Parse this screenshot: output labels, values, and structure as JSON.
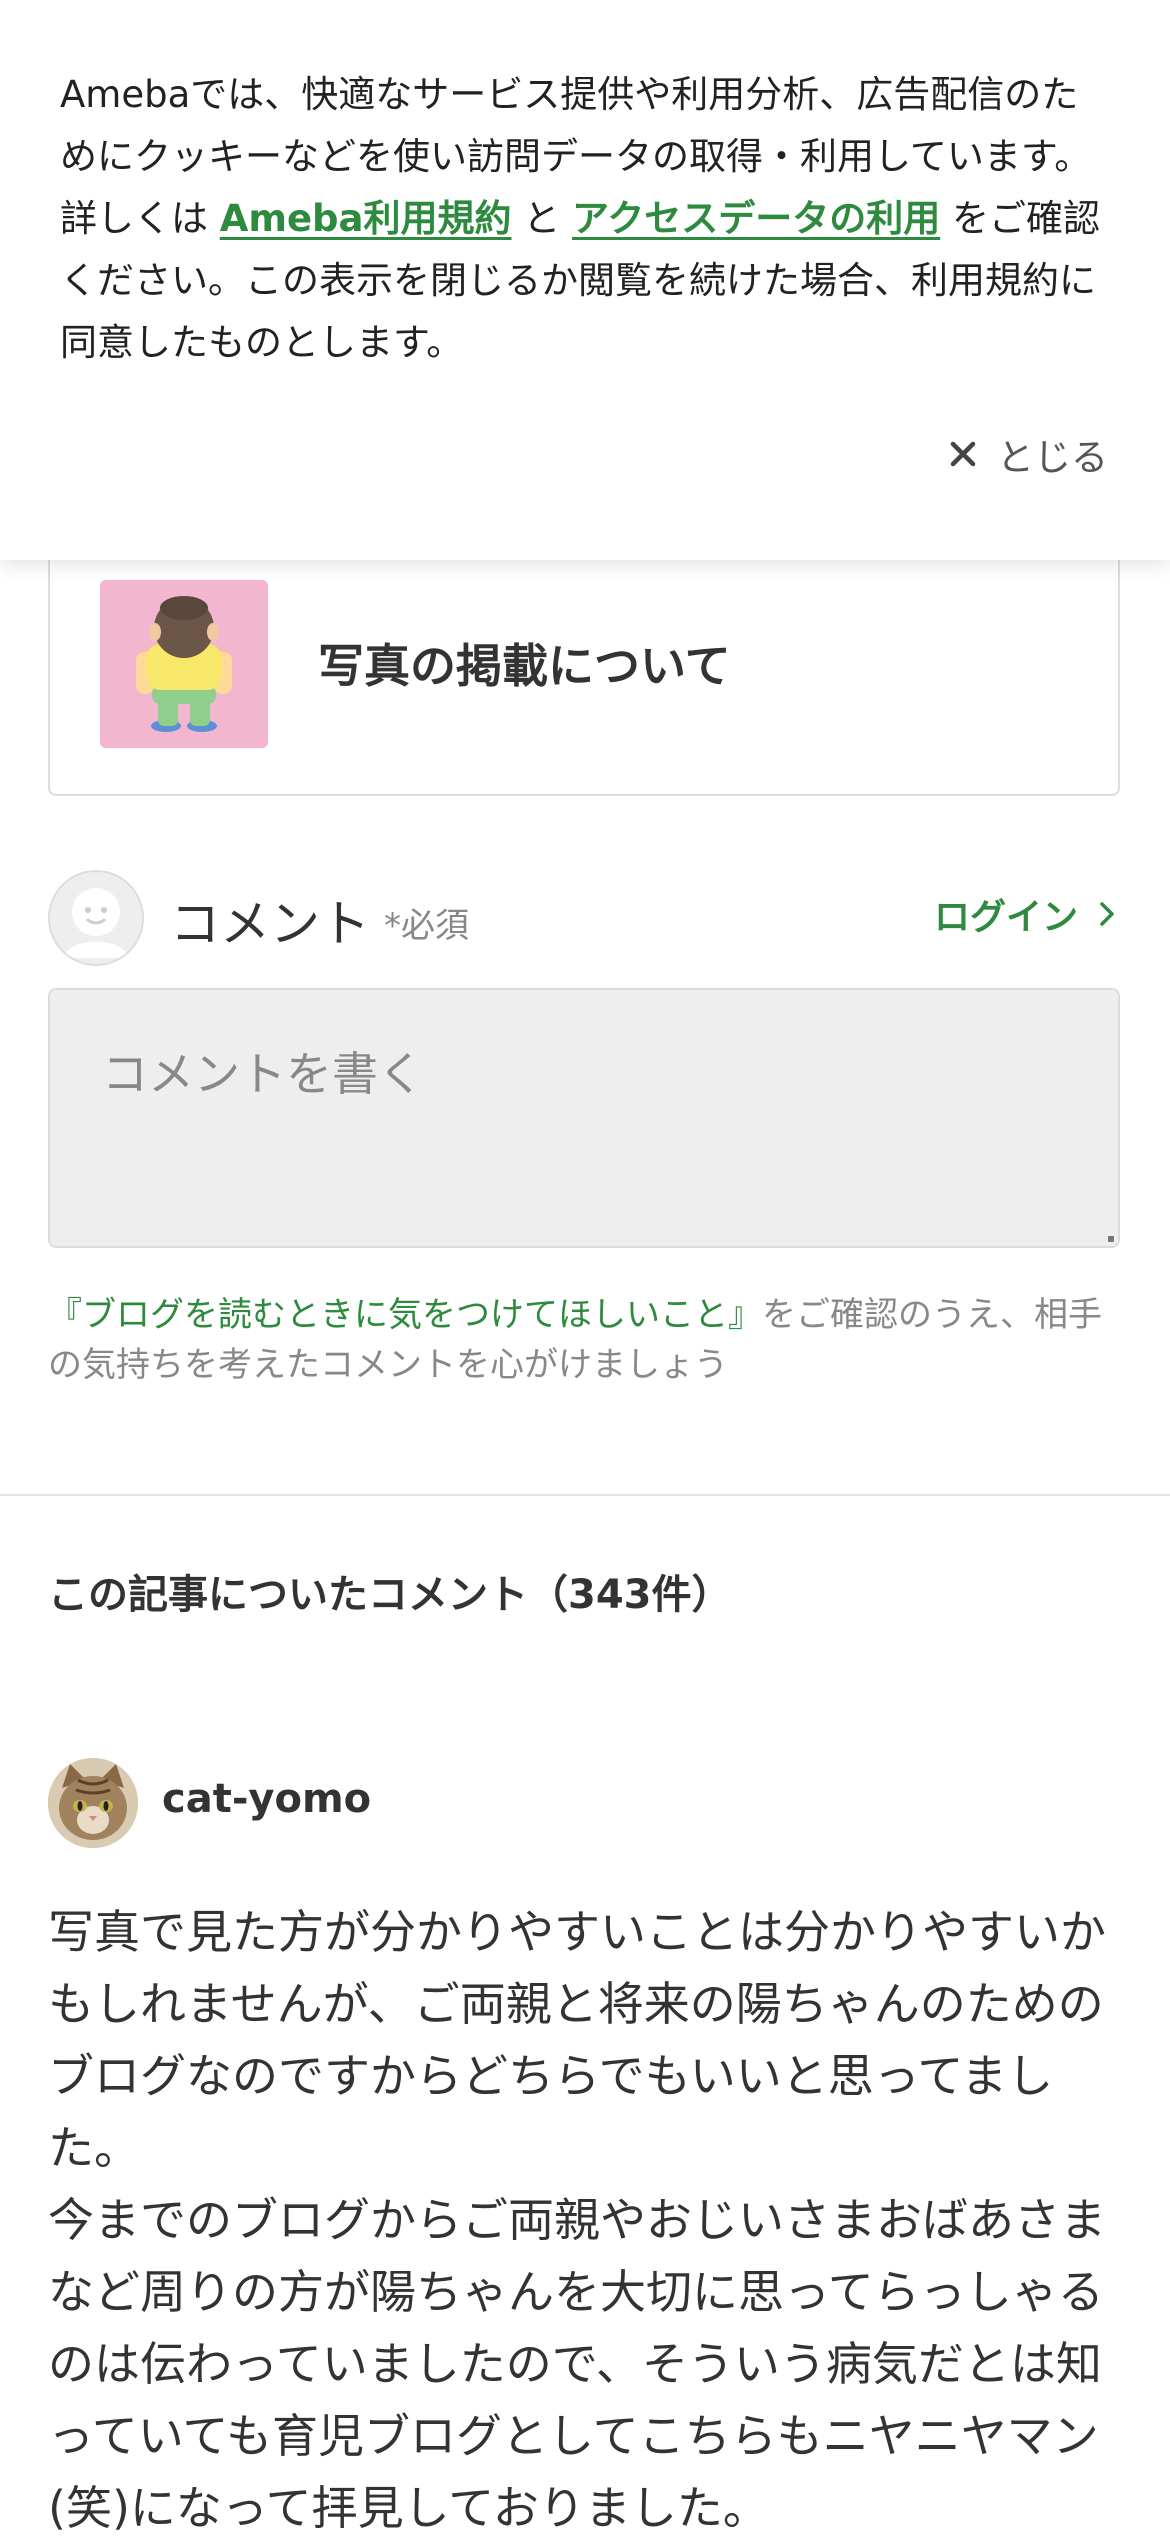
{
  "cookie_banner": {
    "text_before": "Amebaでは、快適なサービス提供や利用分析、広告配信のためにクッキーなどを使い訪問データの取得・利用しています。詳しくは ",
    "terms_link": "Ameba利用規約",
    "text_and": " と ",
    "access_data_link": "アクセスデータの利用",
    "text_after": " をご確認ください。この表示を閉じるか閲覧を続けた場合、利用規約に同意したものとします。",
    "close_label": "とじる"
  },
  "article_card": {
    "title": "写真の掲載について"
  },
  "comment_form": {
    "heading": "コメント",
    "required_mark": "*必須",
    "login_label": "ログイン",
    "placeholder": "コメントを書く",
    "guideline_link": "『ブログを読むときに気をつけてほしいこと』",
    "guideline_text": "をご確認のうえ、相手の気持ちを考えたコメントを心がけましょう"
  },
  "comments_section": {
    "heading": "この記事についたコメント（343件）",
    "comments": [
      {
        "author": "cat-yomo",
        "paragraphs": [
          "写真で見た方が分かりやすいことは分かりやすいかもしれませんが、ご両親と将来の陽ちゃんのためのブログなのですからどちらでもいいと思ってました。",
          "今までのブログからご両親やおじいさまおばあさまなど周りの方が陽ちゃんを大切に思ってらっしゃるのは伝わっていましたので、そういう病気だとは知っていても育児ブログとしてこちらもニヤニヤマン(笑)になって拝見しておりました。"
        ]
      }
    ]
  },
  "colors": {
    "link_green": "#2d8a3e",
    "text_dark": "#333333",
    "text_muted": "#888888",
    "thumb_pink": "#f3b6cf"
  },
  "icons": {
    "close": "close-icon",
    "chevron": "chevron-right-icon",
    "default_avatar": "default-avatar-icon"
  }
}
